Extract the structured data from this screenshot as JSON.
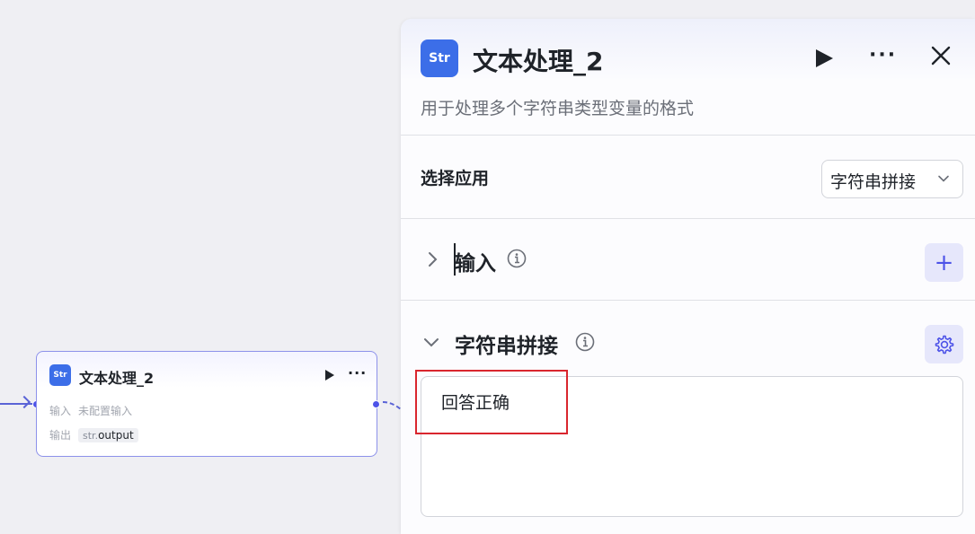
{
  "canvas": {
    "node": {
      "icon_text": "Str",
      "title": "文本处理_2",
      "input_label": "输入",
      "input_value": "未配置输入",
      "output_label": "输出",
      "output_prefix": "str.",
      "output_value": "output"
    }
  },
  "panel": {
    "icon_text": "Str",
    "title": "文本处理_2",
    "description": "用于处理多个字符串类型变量的格式",
    "select_app": {
      "label": "选择应用",
      "selected": "字符串拼接"
    },
    "input_section": {
      "label": "输入"
    },
    "concat_section": {
      "label": "字符串拼接",
      "text_value": "回答正确"
    }
  },
  "colors": {
    "accent": "#4d53e8",
    "icon_bg": "#3c6ee8",
    "highlight": "#d9262e"
  }
}
